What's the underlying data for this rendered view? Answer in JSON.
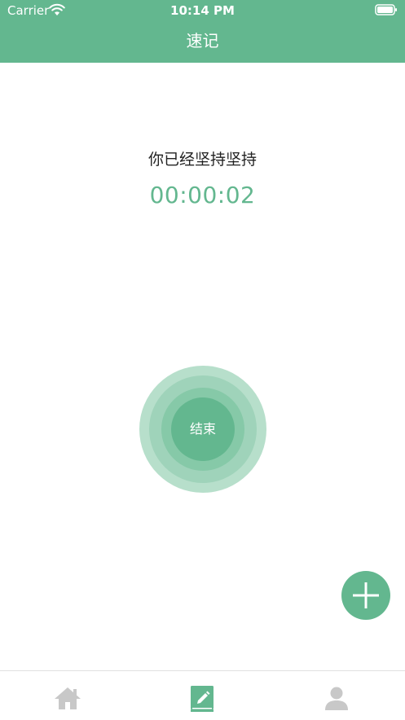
{
  "status_bar": {
    "carrier": "Carrier",
    "time": "10:14 PM"
  },
  "nav": {
    "title": "速记"
  },
  "main": {
    "persist_label": "你已经坚持坚持",
    "timer": "00:00:02",
    "end_button_label": "结束"
  },
  "tabs": [
    {
      "icon": "home-icon",
      "active": false
    },
    {
      "icon": "note-icon",
      "active": true
    },
    {
      "icon": "profile-icon",
      "active": false
    }
  ],
  "colors": {
    "accent": "#63b78f",
    "inactive_icon": "#c8c8c8"
  }
}
